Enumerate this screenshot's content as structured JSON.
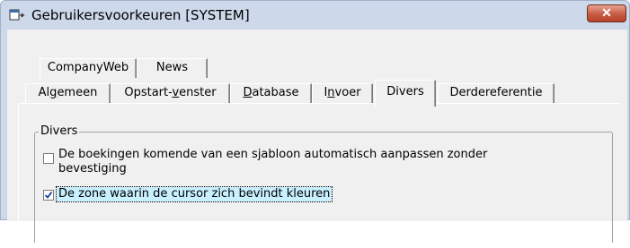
{
  "window": {
    "title": "Gebruikersvoorkeuren [SYSTEM]",
    "close_label": "✕"
  },
  "tabs_row1": [
    {
      "label": "CompanyWeb"
    },
    {
      "label": "News"
    }
  ],
  "tabs_row2": [
    {
      "label_pre": "Al",
      "accel": "g",
      "label_post": "emeen"
    },
    {
      "label_pre": "Opstart-",
      "accel": "v",
      "label_post": "enster"
    },
    {
      "label_pre": "",
      "accel": "D",
      "label_post": "atabase"
    },
    {
      "label_pre": "I",
      "accel": "n",
      "label_post": "voer"
    },
    {
      "label_pre": "Divers",
      "accel": "",
      "label_post": ""
    },
    {
      "label_pre": "Derdereferentie",
      "accel": "",
      "label_post": ""
    }
  ],
  "active_tab": "Divers",
  "group": {
    "title": "Divers",
    "options": [
      {
        "line1": "De boekingen komende van een sjabloon automatisch aanpassen zonder",
        "line2": "bevestiging",
        "checked": false
      },
      {
        "line1": "De zone waarin de cursor zich bevindt kleuren",
        "checked": true
      }
    ]
  }
}
